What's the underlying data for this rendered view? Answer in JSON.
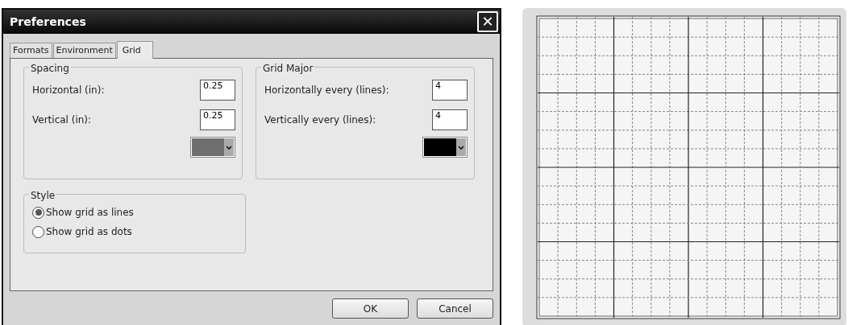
{
  "window": {
    "title": "Preferences",
    "close": "✕"
  },
  "tabs": [
    {
      "label": "Formats",
      "selected": false
    },
    {
      "label": "Environment",
      "selected": false
    },
    {
      "label": "Grid",
      "selected": true
    }
  ],
  "groups": [
    {
      "title": "Spacing",
      "fields": [
        {
          "label": "Horizontal (in):",
          "value": "0.25"
        },
        {
          "label": "Vertical (in):",
          "value": "0.25"
        }
      ],
      "swatch": {
        "color": "#6e6e6e"
      }
    },
    {
      "title": "Grid Major",
      "fields": [
        {
          "label": "Horizontally every (lines):",
          "value": "4"
        },
        {
          "label": "Vertically every (lines):",
          "value": "4"
        }
      ],
      "swatch": {
        "color": "#000000"
      }
    }
  ],
  "style": {
    "title": "Style",
    "options": [
      {
        "label": "Show grid as lines",
        "selected": true
      },
      {
        "label": "Show grid as dots",
        "selected": false
      }
    ]
  },
  "buttons": [
    "OK",
    "Cancel"
  ]
}
